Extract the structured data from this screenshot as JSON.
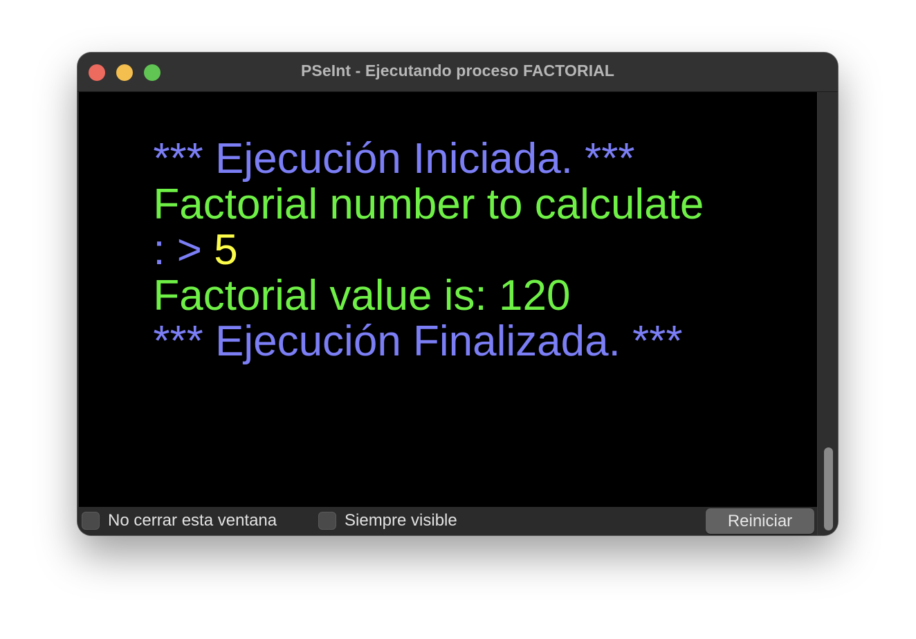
{
  "window": {
    "title": "PSeInt - Ejecutando proceso FACTORIAL"
  },
  "console": {
    "lines": [
      {
        "segments": [
          {
            "text": "*** Ejecución Iniciada. ***",
            "color": "#7b7ef5"
          }
        ]
      },
      {
        "segments": [
          {
            "text": "Factorial number to calculate",
            "color": "#6ff046"
          }
        ]
      },
      {
        "segments": [
          {
            "text": ": > ",
            "color": "#7b7ef5"
          },
          {
            "text": "5",
            "color": "#fbfb4a"
          }
        ]
      },
      {
        "segments": [
          {
            "text": "Factorial value is: 120",
            "color": "#6ff046"
          }
        ]
      },
      {
        "segments": [
          {
            "text": "*** Ejecución Finalizada. ***",
            "color": "#7b7ef5"
          }
        ]
      }
    ]
  },
  "bottom_bar": {
    "checkbox_keep_open": {
      "label": "No cerrar esta ventana",
      "checked": false
    },
    "checkbox_always_visible": {
      "label": "Siempre visible",
      "checked": false
    },
    "reset_button": {
      "label": "Reiniciar"
    }
  }
}
